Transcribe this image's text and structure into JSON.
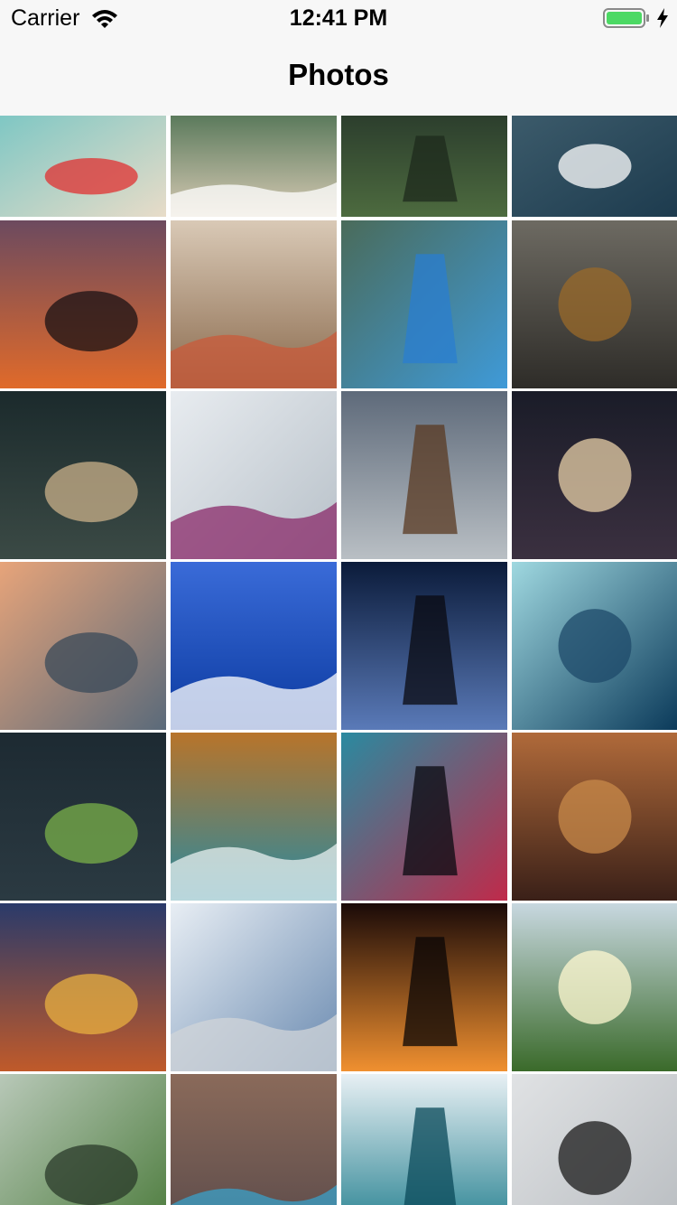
{
  "status_bar": {
    "carrier": "Carrier",
    "time": "12:41 PM",
    "battery_color": "#4cd964"
  },
  "nav": {
    "title": "Photos"
  },
  "grid": {
    "columns": 4,
    "photos": [
      {
        "name": "photo-beach-aerial",
        "grad": [
          "#7fc7c4",
          "#e8dcc8"
        ],
        "accent": "#e03030"
      },
      {
        "name": "photo-shore-waves",
        "grad": [
          "#5b7a5c",
          "#d8cbb5"
        ],
        "accent": "#ffffff"
      },
      {
        "name": "photo-canyon-green",
        "grad": [
          "#2c3e2d",
          "#4d6b3f"
        ],
        "accent": "#1d2a1c"
      },
      {
        "name": "photo-sailboat-sea",
        "grad": [
          "#3c5b6b",
          "#1d3b4e"
        ],
        "accent": "#ffffff"
      },
      {
        "name": "photo-sunset-dog",
        "grad": [
          "#6c4a5f",
          "#e06a2a"
        ],
        "accent": "#1a1214"
      },
      {
        "name": "photo-colonial-street",
        "grad": [
          "#d9c9b6",
          "#8a6a4d"
        ],
        "accent": "#c95a3a"
      },
      {
        "name": "photo-pool-aerial",
        "grad": [
          "#4a6b5a",
          "#3f9ad8"
        ],
        "accent": "#2a7ed0"
      },
      {
        "name": "photo-crocodile-eye",
        "grad": [
          "#6d6a62",
          "#2e2c28"
        ],
        "accent": "#9a6a2a"
      },
      {
        "name": "photo-milky-way",
        "grad": [
          "#1b2a2c",
          "#3b4a45"
        ],
        "accent": "#c9b08a"
      },
      {
        "name": "photo-pancakes",
        "grad": [
          "#e8ecf0",
          "#b7c0c8"
        ],
        "accent": "#8a2a6a"
      },
      {
        "name": "photo-lighthouse",
        "grad": [
          "#5e6a7a",
          "#b9bfc4"
        ],
        "accent": "#5a3a22"
      },
      {
        "name": "photo-night-cave",
        "grad": [
          "#1a1c28",
          "#3b3040"
        ],
        "accent": "#e8d0a8"
      },
      {
        "name": "photo-misty-mountains",
        "grad": [
          "#e7a47a",
          "#5a6a7a"
        ],
        "accent": "#3a4a5a"
      },
      {
        "name": "photo-wind-turbine-sea",
        "grad": [
          "#3a6bd8",
          "#0b3aa0"
        ],
        "accent": "#ffffff"
      },
      {
        "name": "photo-moon-forest",
        "grad": [
          "#0b1b3a",
          "#5a7ab8"
        ],
        "accent": "#0a0a10"
      },
      {
        "name": "photo-underwater-diver",
        "grad": [
          "#9fd8e0",
          "#0b3a5a"
        ],
        "accent": "#1d4a6a"
      },
      {
        "name": "photo-cabbage-bowl",
        "grad": [
          "#1d2a32",
          "#2b3a42"
        ],
        "accent": "#7ab04a"
      },
      {
        "name": "photo-coast-aerial",
        "grad": [
          "#b8742a",
          "#2a8aa0"
        ],
        "accent": "#e8f0f0"
      },
      {
        "name": "photo-neon-city",
        "grad": [
          "#2a8aa0",
          "#c02a4a"
        ],
        "accent": "#0a0a10"
      },
      {
        "name": "photo-old-windmill",
        "grad": [
          "#b06a3a",
          "#3a2018"
        ],
        "accent": "#c88a4a"
      },
      {
        "name": "photo-market-night",
        "grad": [
          "#2a3a6a",
          "#c05a2a"
        ],
        "accent": "#e8b040"
      },
      {
        "name": "photo-newspaper",
        "grad": [
          "#e8eef4",
          "#6a8ab0"
        ],
        "accent": "#d0d4d8"
      },
      {
        "name": "photo-orange-sunset",
        "grad": [
          "#1a0a08",
          "#f09030"
        ],
        "accent": "#0a0606"
      },
      {
        "name": "photo-green-valley",
        "grad": [
          "#c8d8e0",
          "#3a6a2a"
        ],
        "accent": "#fff8d0"
      },
      {
        "name": "photo-misty-forest",
        "grad": [
          "#b8c8b8",
          "#4a7a3a"
        ],
        "accent": "#2a3a2a"
      },
      {
        "name": "photo-crowd-stadium",
        "grad": [
          "#8a6a5a",
          "#5a4a4a"
        ],
        "accent": "#3aa0c8"
      },
      {
        "name": "photo-ocean-wave",
        "grad": [
          "#e8f0f4",
          "#1a7a8a"
        ],
        "accent": "#0a4a5a"
      },
      {
        "name": "photo-desk-workspace",
        "grad": [
          "#e0e2e4",
          "#b8bcc0"
        ],
        "accent": "#1a1a1a"
      }
    ]
  }
}
